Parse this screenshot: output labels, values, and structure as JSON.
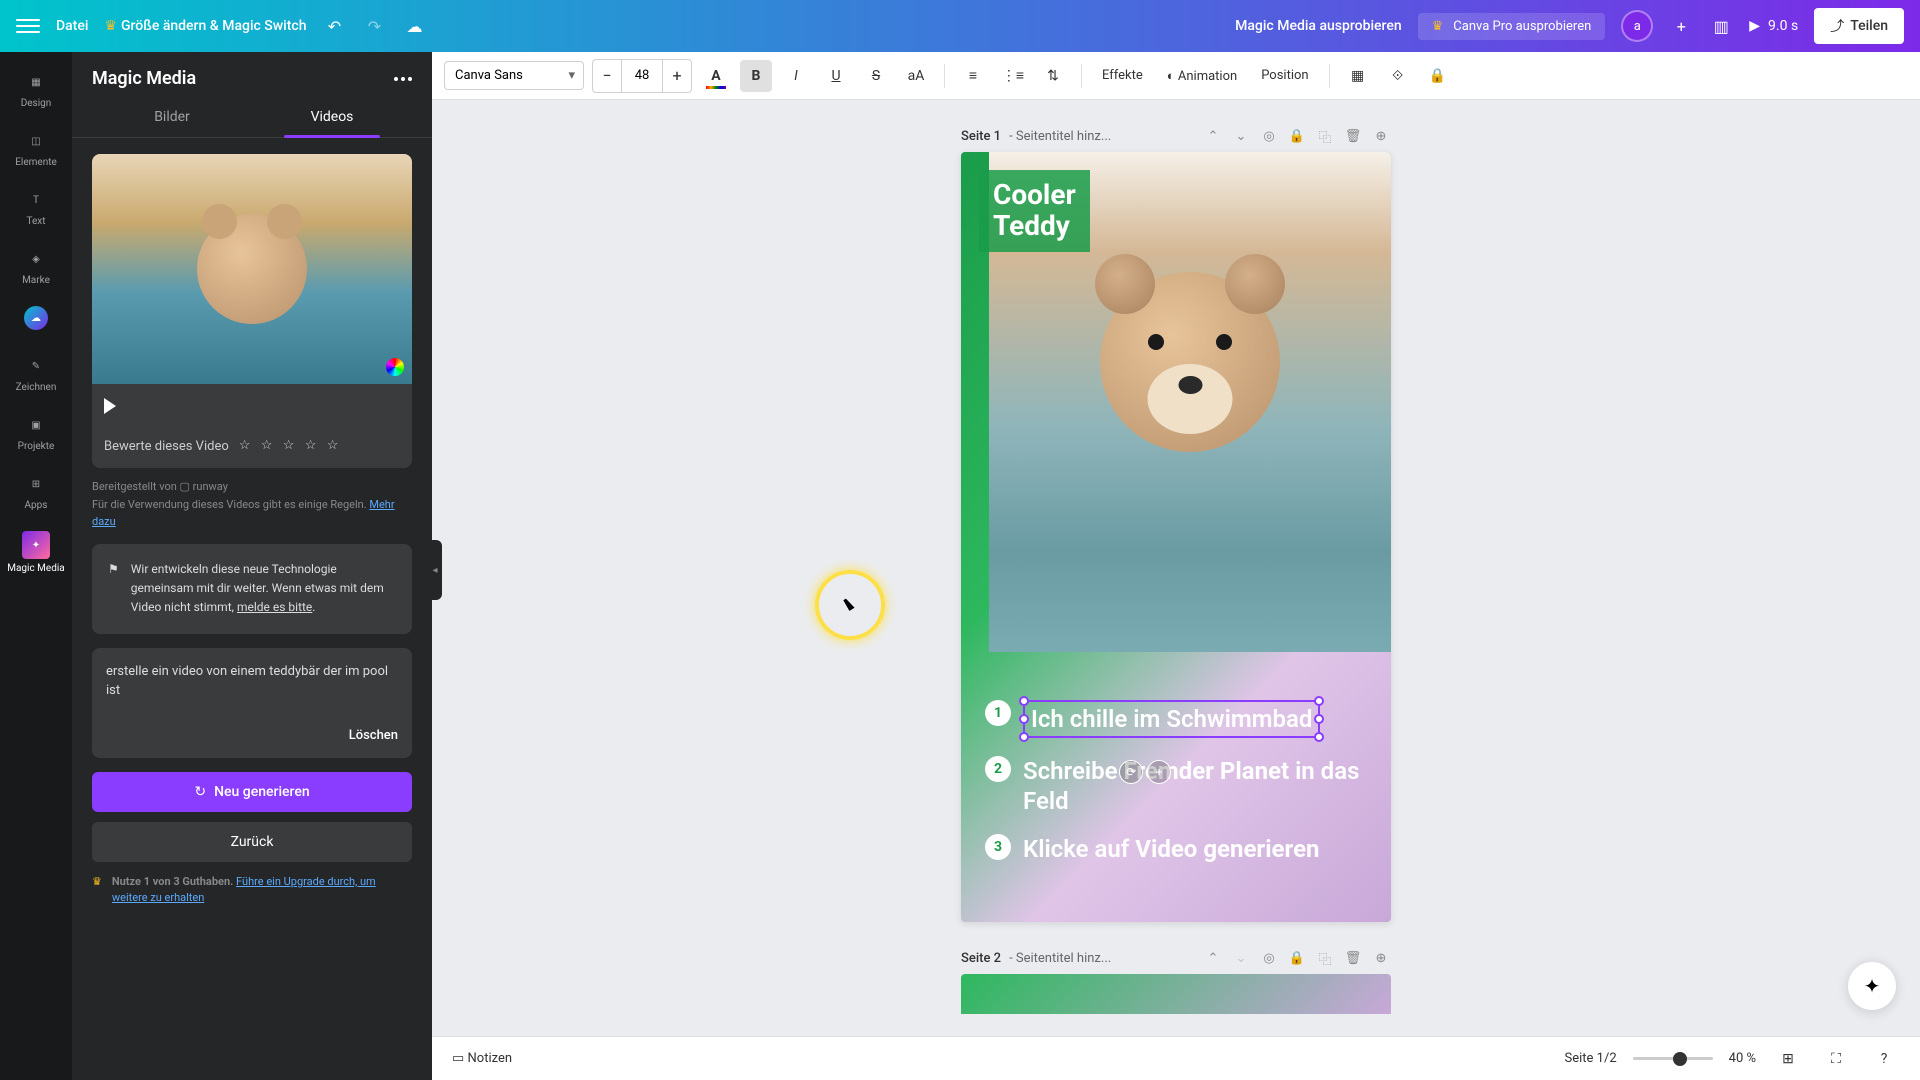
{
  "topbar": {
    "file": "Datei",
    "resize": "Größe ändern & Magic Switch",
    "doc_title": "Magic Media ausprobieren",
    "pro_cta": "Canva Pro ausprobieren",
    "avatar": "a",
    "duration": "9.0 s",
    "share": "Teilen"
  },
  "sidebar": {
    "items": [
      {
        "label": "Design"
      },
      {
        "label": "Elemente"
      },
      {
        "label": "Text"
      },
      {
        "label": "Marke"
      },
      {
        "label": ""
      },
      {
        "label": "Zeichnen"
      },
      {
        "label": "Projekte"
      },
      {
        "label": "Apps"
      },
      {
        "label": "Magic Media"
      }
    ]
  },
  "panel": {
    "title": "Magic Media",
    "tabs": {
      "images": "Bilder",
      "videos": "Videos"
    },
    "rating_label": "Bewerte dieses Video",
    "provider": "Bereitgestellt von ▢ runway",
    "rules_text": "Für die Verwendung dieses Videos gibt es einige Regeln. ",
    "rules_link": "Mehr dazu",
    "info_text": "Wir entwickeln diese neue Technologie gemeinsam mit dir weiter. Wenn etwas mit dem Video nicht stimmt, ",
    "info_link": "melde es bitte",
    "prompt": "erstelle ein video von einem teddybär der im pool ist",
    "delete": "Löschen",
    "generate": "Neu generieren",
    "back": "Zurück",
    "credits_bold": "Nutze 1 von 3 Guthaben. ",
    "credits_link": "Führe ein Upgrade durch, um weitere zu erhalten"
  },
  "toolbar": {
    "font": "Canva Sans",
    "size": "48",
    "effects": "Effekte",
    "animation": "Animation",
    "position": "Position"
  },
  "page1": {
    "label": "Seite 1",
    "placeholder": "Seitentitel hinz...",
    "title_line1": "Cooler",
    "title_line2": "Teddy",
    "step1": "Ich chille im Schwimmbad",
    "step2_a": "Schreibe ",
    "step2_b": "Fremder Planet",
    "step2_c": " in das Feld",
    "step3_a": "Klicke auf ",
    "step3_b": "Video generieren"
  },
  "page2": {
    "label": "Seite 2",
    "placeholder": "Seitentitel hinz..."
  },
  "bottom": {
    "notes": "Notizen",
    "page_count": "Seite 1/2",
    "zoom": "40 %"
  }
}
